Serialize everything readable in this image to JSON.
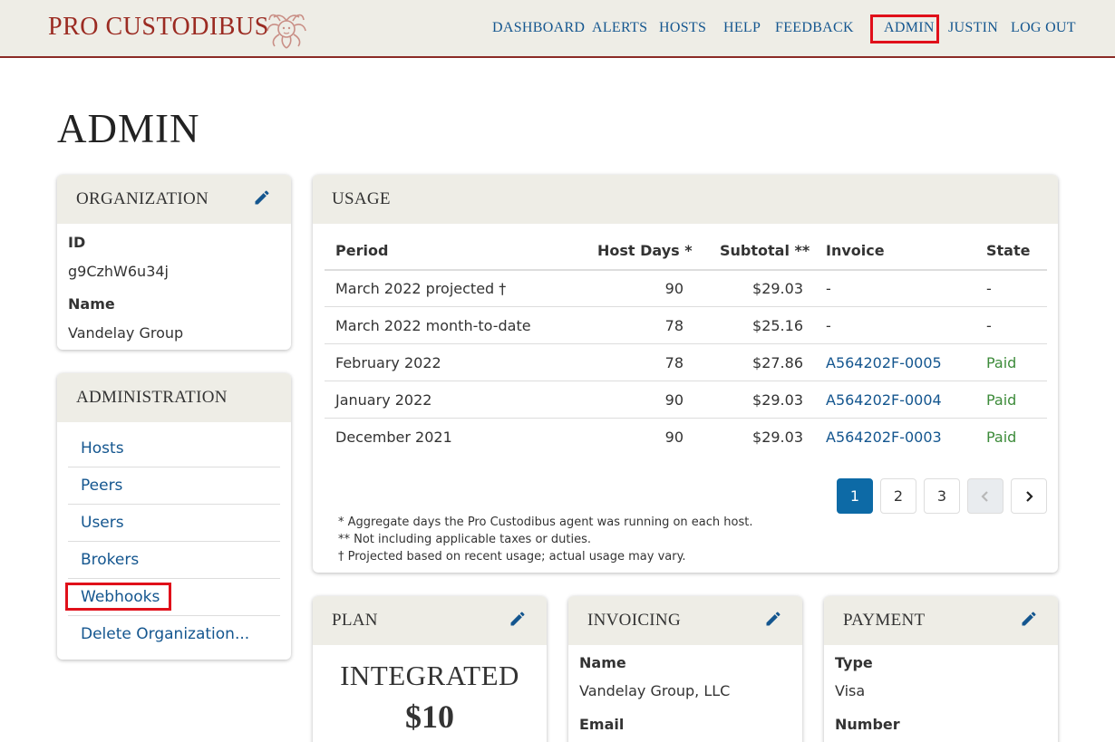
{
  "app": {
    "brand": "PRO CUSTODIBUS",
    "nav": [
      "DASHBOARD",
      "ALERTS",
      "HOSTS",
      "HELP",
      "FEEDBACK",
      "ADMIN",
      "JUSTIN",
      "LOG OUT"
    ]
  },
  "page": {
    "title": "ADMIN"
  },
  "organization": {
    "title": "ORGANIZATION",
    "id_label": "ID",
    "id_value": "g9CzhW6u34j",
    "name_label": "Name",
    "name_value": "Vandelay Group"
  },
  "administration": {
    "title": "ADMINISTRATION",
    "links": [
      "Hosts",
      "Peers",
      "Users",
      "Brokers",
      "Webhooks",
      "Delete Organization..."
    ]
  },
  "usage": {
    "title": "USAGE",
    "columns": [
      "Period",
      "Host Days *",
      "Subtotal **",
      "Invoice",
      "State"
    ],
    "rows": [
      [
        "March 2022 projected †",
        "90",
        "$29.03",
        "-",
        "-"
      ],
      [
        "March 2022 month-to-date",
        "78",
        "$25.16",
        "-",
        "-"
      ],
      [
        "February 2022",
        "78",
        "$27.86",
        "A564202F-0005",
        "Paid"
      ],
      [
        "January 2022",
        "90",
        "$29.03",
        "A564202F-0004",
        "Paid"
      ],
      [
        "December 2021",
        "90",
        "$29.03",
        "A564202F-0003",
        "Paid"
      ]
    ],
    "pagination": [
      "1",
      "2",
      "3"
    ],
    "notes": [
      "* Aggregate days the Pro Custodibus agent was running on each host.",
      "** Not including applicable taxes or duties.",
      "† Projected based on recent usage; actual usage may vary."
    ]
  },
  "plan": {
    "title": "PLAN",
    "name": "INTEGRATED",
    "price": "$10"
  },
  "invoicing": {
    "title": "INVOICING",
    "name_label": "Name",
    "name_value": "Vandelay Group, LLC",
    "email_label": "Email"
  },
  "payment": {
    "title": "PAYMENT",
    "type_label": "Type",
    "type_value": "Visa",
    "number_label": "Number"
  },
  "colors": {
    "brand": "#9b2b22",
    "link": "#14568f",
    "paid": "#3d8b3a",
    "active_page": "#0d6aa6",
    "highlight": "#e0101a",
    "header_bg": "#eeede6"
  },
  "icons": [
    "medusa-logo",
    "pencil-icon",
    "chevron-left-icon",
    "chevron-right-icon"
  ]
}
